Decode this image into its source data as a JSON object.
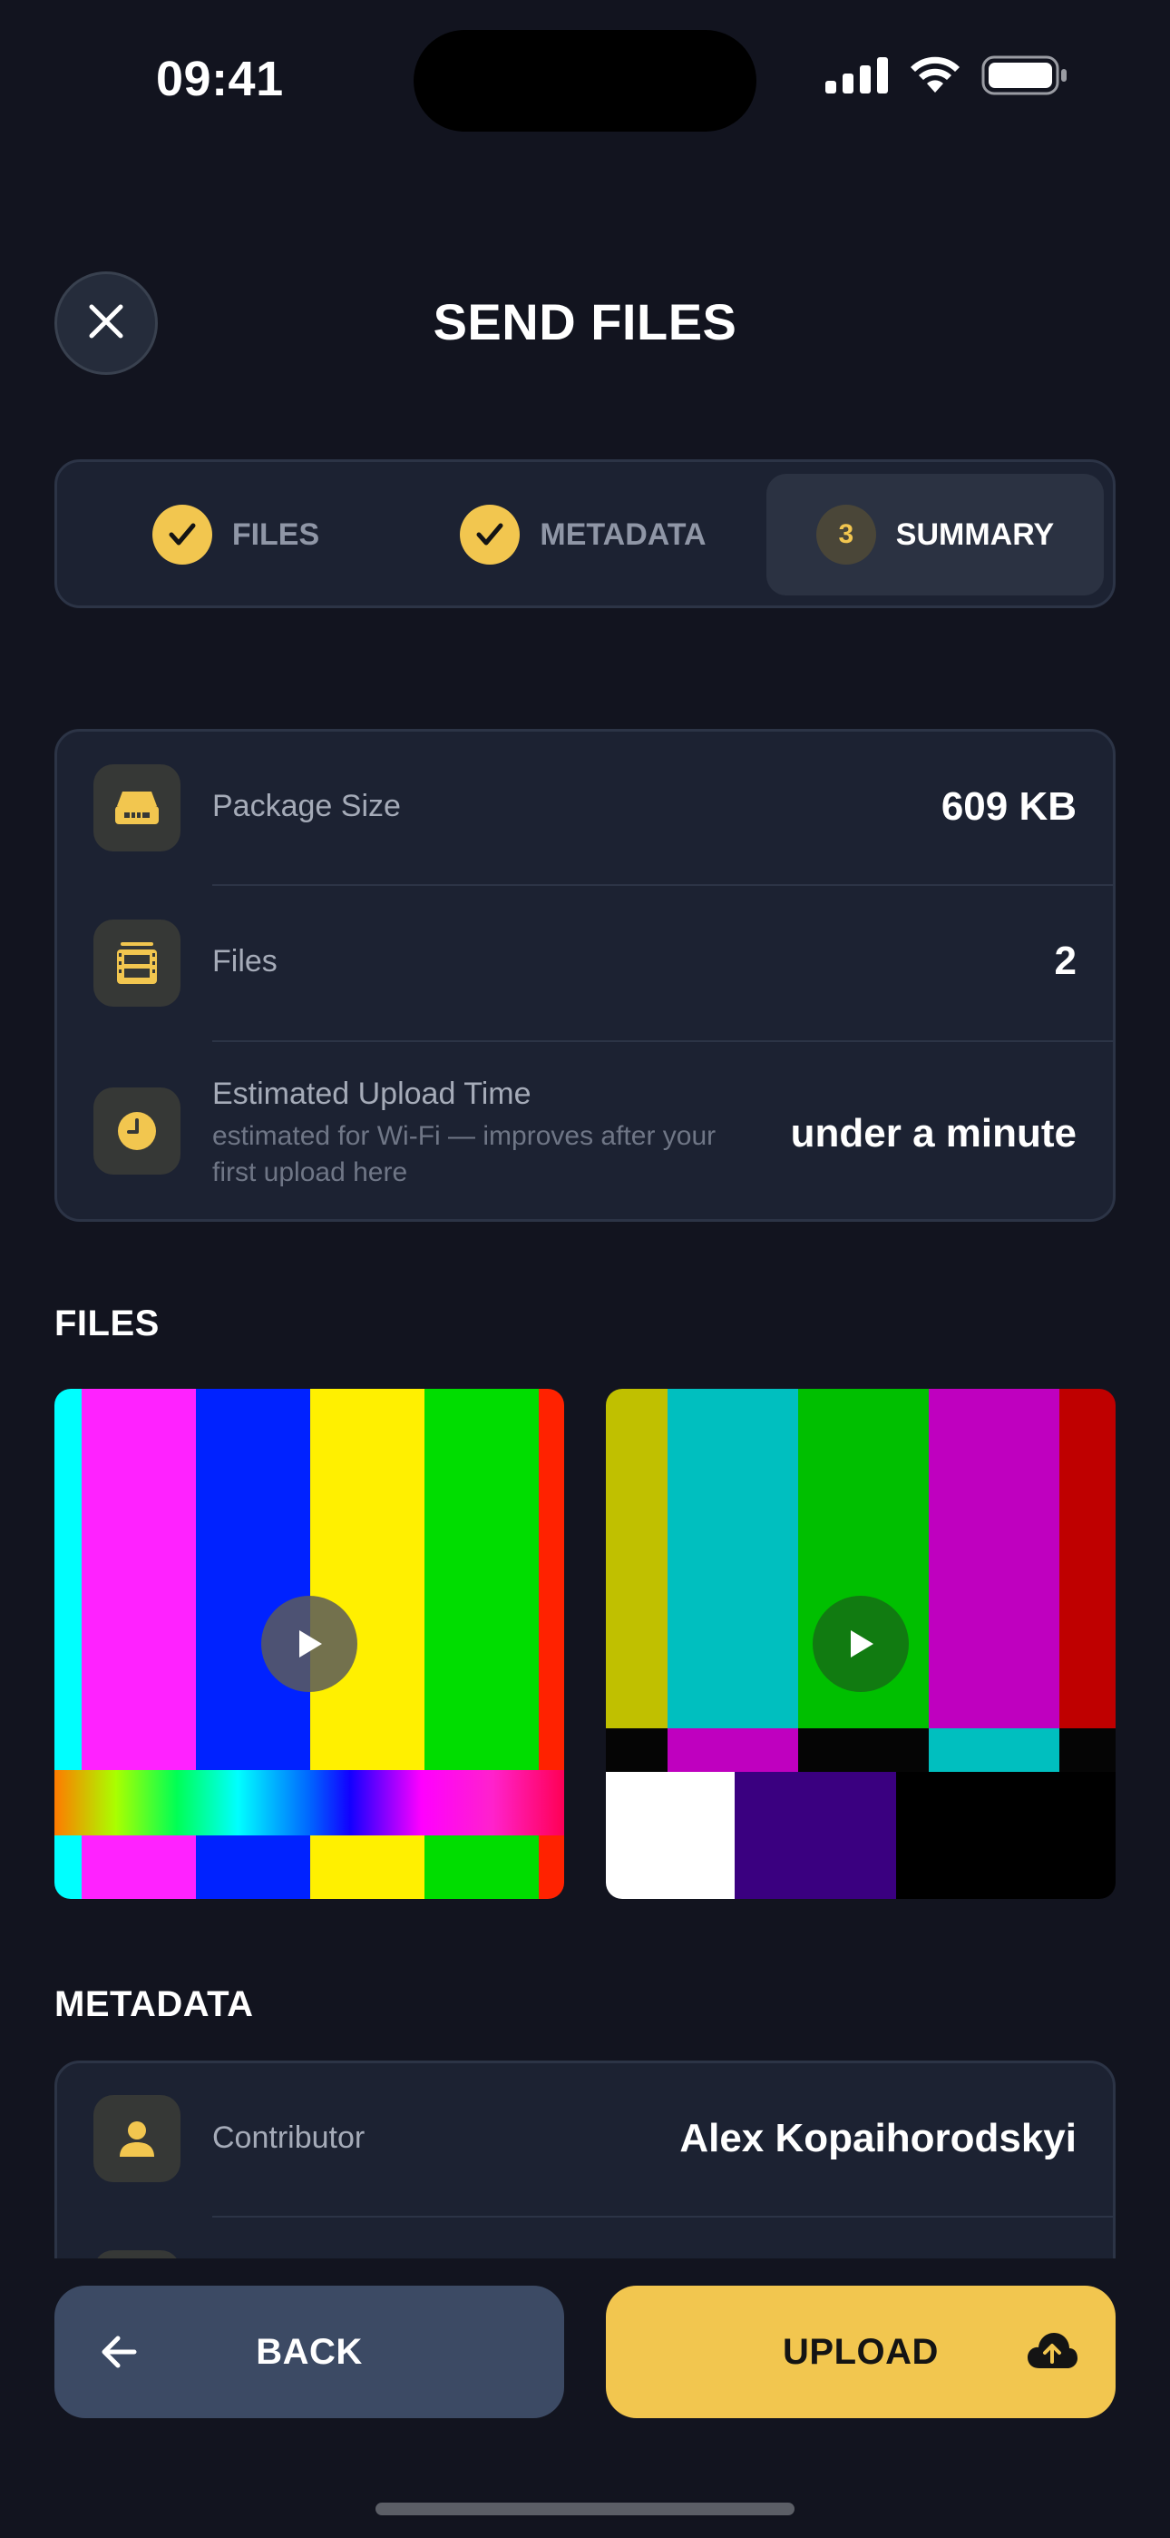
{
  "status_bar": {
    "time": "09:41"
  },
  "header": {
    "title": "SEND FILES"
  },
  "stepper": {
    "steps": [
      {
        "label": "FILES",
        "state": "done"
      },
      {
        "label": "METADATA",
        "state": "done"
      },
      {
        "label": "SUMMARY",
        "number": "3",
        "state": "active"
      }
    ]
  },
  "summary": {
    "package_size": {
      "label": "Package Size",
      "value": "609 KB",
      "icon": "drive-icon"
    },
    "files": {
      "label": "Files",
      "value": "2",
      "icon": "film-icon"
    },
    "upload_time": {
      "label": "Estimated Upload Time",
      "sublabel": "estimated for Wi-Fi — improves after your first upload here",
      "value": "under a minute",
      "icon": "clock-icon"
    }
  },
  "files_section": {
    "title": "FILES"
  },
  "metadata_section": {
    "title": "METADATA",
    "contributor": {
      "label": "Contributor",
      "value": "Alex Kopaihorodskyi",
      "icon": "person-icon"
    }
  },
  "buttons": {
    "back": "BACK",
    "upload": "UPLOAD"
  },
  "colors": {
    "accent": "#f2c64f",
    "background": "#12141f",
    "card": "#1c2232",
    "back_button": "#3c4a64"
  }
}
